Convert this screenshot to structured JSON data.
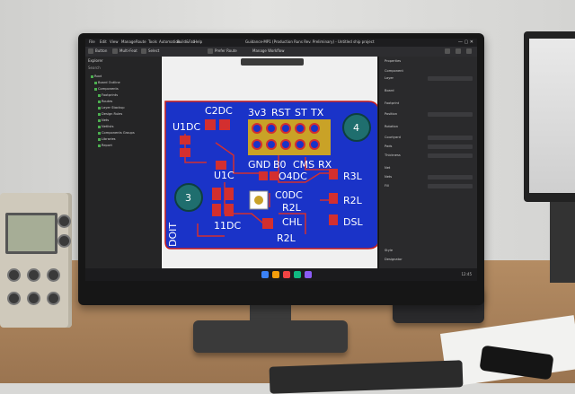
{
  "app": {
    "title": "Guidance-MP1 (Production Runs Rev. Preliminary) - Untitled ship project",
    "menu": [
      "File",
      "Edit",
      "View",
      "Manage",
      "Route",
      "Tools",
      "Automation",
      "Build&Fab",
      "Help"
    ],
    "toolbar": [
      "Button",
      "Multi-Feat",
      "Select",
      "Prefer Route",
      "Manage Workflow"
    ],
    "window_controls": "— ▢ ✕"
  },
  "left_panel": {
    "header": "Explorer",
    "search_placeholder": "Search",
    "tree": [
      "Root",
      "Board Outline",
      "Components",
      "Footprints",
      "Routes",
      "Layer Stackup",
      "Design Rules",
      "Nets",
      "Netlists",
      "Components Groups",
      "Libraries",
      "Report"
    ]
  },
  "pcb": {
    "board_color": "#1a33c8",
    "board_edge": "#c81e1e",
    "header_top_labels": [
      "3v3",
      "RST",
      "ST",
      "TX"
    ],
    "header_bottom_labels": [
      "GND",
      "B0",
      "CMS",
      "RX"
    ],
    "mount_labels": [
      "4",
      "3"
    ],
    "refdes": [
      "C2DC",
      "U1DC",
      "U1C",
      "O4DC",
      "C0DC",
      "R2L",
      "CHL",
      "R2L",
      "11DC",
      "R3L",
      "R2L",
      "DSL",
      "DOIT"
    ]
  },
  "right_panel": {
    "header": "Properties",
    "rows": [
      "Component",
      "Layer",
      "Board",
      "Footprint",
      "Position",
      "Rotation",
      "Courtyard",
      "Pads",
      "Thickness",
      "Net",
      "Nets",
      "Fill",
      "Style",
      "Designator"
    ]
  },
  "taskbar": {
    "tray": "12:45"
  },
  "colors": {
    "screen_bg": "#252526",
    "canvas_bg": "#f0f0f0",
    "copper": "#d32f2f",
    "pad_gold": "#c9a227",
    "accent_green": "#4caf50"
  }
}
